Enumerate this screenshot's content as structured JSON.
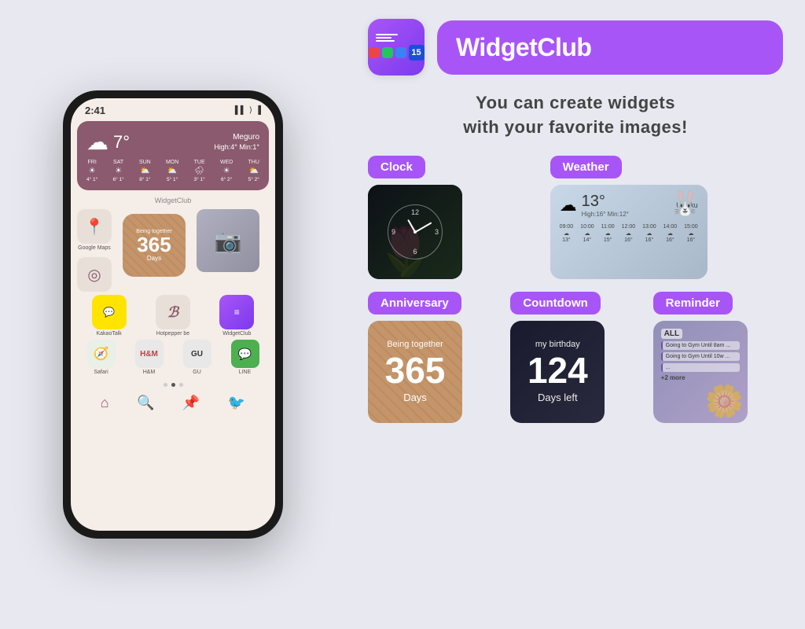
{
  "app": {
    "brand_name": "WidgetClub",
    "tagline_line1": "You can create widgets",
    "tagline_line2": "with your favorite images!"
  },
  "phone": {
    "time": "2:41",
    "status": "▌▌ ⟩ 🔋",
    "widget_club_label": "WidgetClub",
    "weather": {
      "temp": "7°",
      "location": "Meguro",
      "high_low": "High:4° Min:1°",
      "cloud_icon": "☁",
      "days": [
        {
          "name": "FRI",
          "icon": "☀",
          "temps": "4° 1°"
        },
        {
          "name": "SAT",
          "icon": "☀",
          "temps": "6° 1°"
        },
        {
          "name": "SUN",
          "icon": "⛅",
          "temps": "8° 1°"
        },
        {
          "name": "MON",
          "icon": "⛅",
          "temps": "5° 1°"
        },
        {
          "name": "TUE",
          "icon": "🌧",
          "temps": "3° 1°"
        },
        {
          "name": "WED",
          "icon": "☀",
          "temps": "6° 2°"
        },
        {
          "name": "THU",
          "icon": "⛅",
          "temps": "5° 2°"
        }
      ]
    },
    "apps": [
      {
        "name": "Google Maps",
        "icon": "📍"
      },
      {
        "name": "KakaoTalk",
        "icon": "💬"
      },
      {
        "name": "Hotpepper be",
        "icon": "𝔅"
      },
      {
        "name": "WidgetClub",
        "icon": "📷"
      },
      {
        "name": "Safari",
        "icon": "🧭"
      },
      {
        "name": "H&M",
        "icon": "H&M"
      },
      {
        "name": "GU",
        "icon": "GU"
      },
      {
        "name": "LINE",
        "icon": "💬"
      }
    ],
    "anniversary": {
      "label": "Being together",
      "number": "365",
      "unit": "Days"
    }
  },
  "categories": [
    {
      "id": "clock",
      "label": "Clock",
      "label_color": "label-purple"
    },
    {
      "id": "weather",
      "label": "Weather",
      "label_color": "label-purple"
    },
    {
      "id": "anniversary",
      "label": "Anniversary",
      "label_color": "label-purple"
    },
    {
      "id": "countdown",
      "label": "Countdown",
      "label_color": "label-purple"
    },
    {
      "id": "reminder",
      "label": "Reminder",
      "label_color": "label-purple"
    }
  ],
  "weather_preview": {
    "temp": "13°",
    "location": "Ushiku",
    "high_low": "High:16° Min:12°",
    "times": [
      "09:00",
      "10:00",
      "11:00",
      "12:00",
      "13:00",
      "14:00",
      "15:00"
    ],
    "temps": [
      "13°",
      "14°",
      "15°",
      "16°",
      "16°",
      "16°",
      "16°"
    ]
  },
  "anniversary_preview": {
    "label": "Being together",
    "number": "365",
    "unit": "Days"
  },
  "countdown_preview": {
    "title": "my birthday",
    "number": "124",
    "label": "Days left"
  },
  "reminder_preview": {
    "all_label": "ALL",
    "items": [
      "Going to Gym Until 8am ...",
      "Going to Gym Until 10w ...",
      "..."
    ],
    "more": "+2 more"
  }
}
